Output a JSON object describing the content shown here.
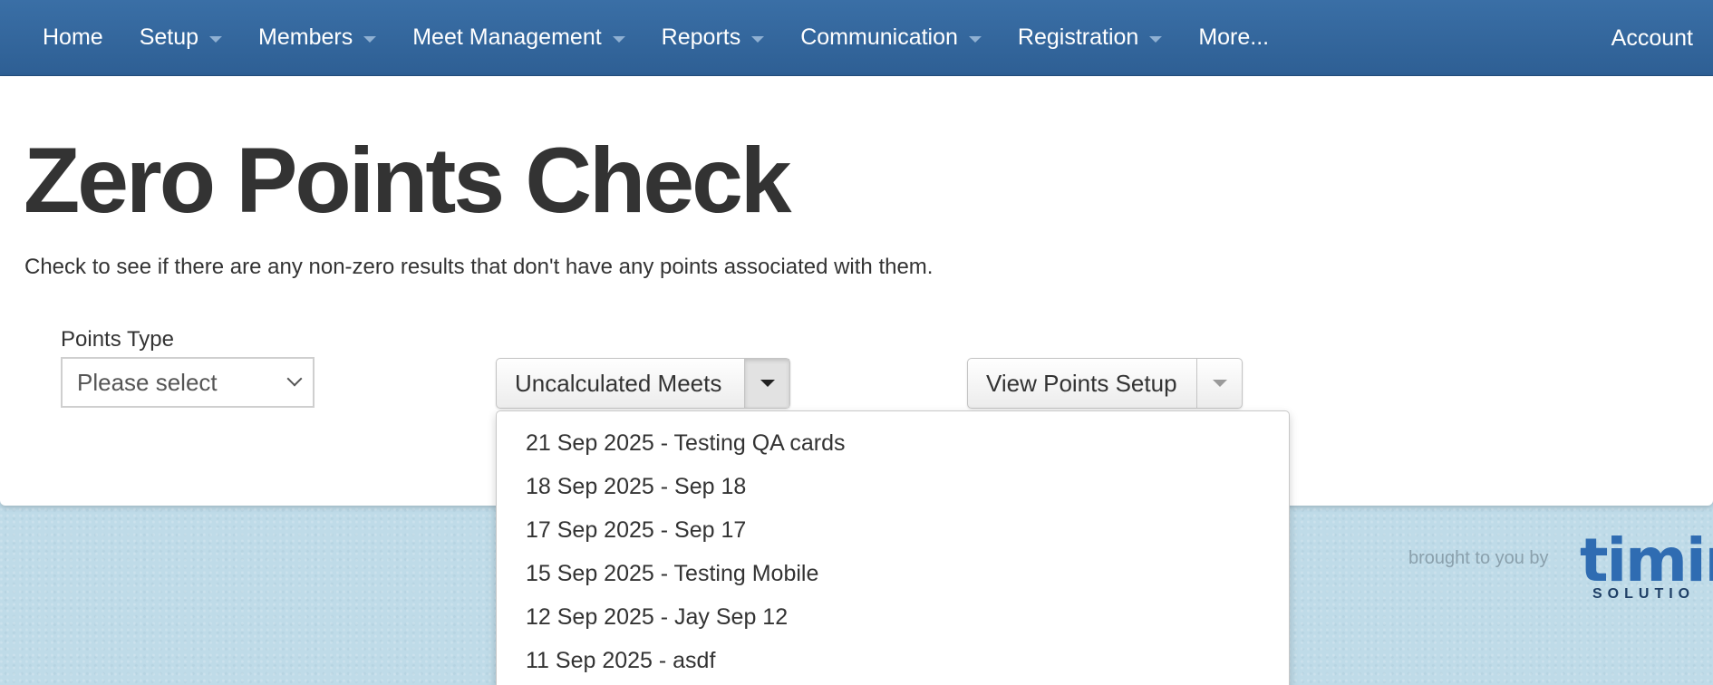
{
  "nav": {
    "items": [
      {
        "label": "Home",
        "has_caret": false
      },
      {
        "label": "Setup",
        "has_caret": true
      },
      {
        "label": "Members",
        "has_caret": true
      },
      {
        "label": "Meet Management",
        "has_caret": true
      },
      {
        "label": "Reports",
        "has_caret": true
      },
      {
        "label": "Communication",
        "has_caret": true
      },
      {
        "label": "Registration",
        "has_caret": true
      },
      {
        "label": "More...",
        "has_caret": false
      }
    ],
    "account_label": "Account"
  },
  "page": {
    "title": "Zero Points Check",
    "description": "Check to see if there are any non-zero results that don't have any points associated with them."
  },
  "form": {
    "points_type_label": "Points Type",
    "points_type_value": "Please select"
  },
  "buttons": {
    "uncalculated_meets": "Uncalculated Meets",
    "view_points_setup": "View Points Setup"
  },
  "dropdown": {
    "items": [
      "21 Sep 2025 - Testing QA cards",
      "18 Sep 2025 - Sep 18",
      "17 Sep 2025 - Sep 17",
      "15 Sep 2025 - Testing Mobile",
      "12 Sep 2025 - Jay Sep 12",
      "11 Sep 2025 - asdf"
    ]
  },
  "footer": {
    "brought_to_you_by": "brought to you by",
    "logo_text": "timin",
    "logo_subtext": "SOLUTIO"
  },
  "colors": {
    "navbar": "#2e5f94",
    "logo_blue": "#2f6cb2",
    "background": "#bfdbe8"
  }
}
